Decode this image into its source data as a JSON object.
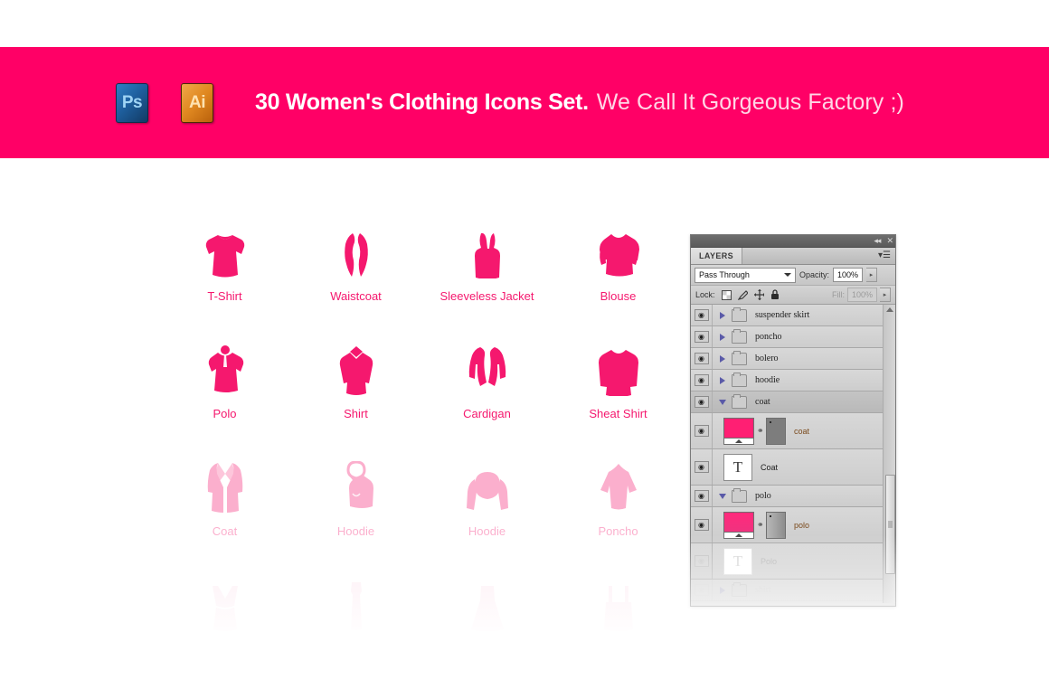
{
  "banner": {
    "background_color": "#ff0066",
    "badges": [
      {
        "name": "photoshop-badge",
        "label": "Ps"
      },
      {
        "name": "illustrator-badge",
        "label": "Ai"
      }
    ],
    "title_bold": "30 Women's Clothing Icons Set.",
    "title_light": "We Call It  Gorgeous Factory ;)"
  },
  "icon_grid": {
    "accent_color": "#f5186e",
    "rows": [
      {
        "opacity_class": "",
        "cells": [
          {
            "icon": "tshirt-icon",
            "label": "T-Shirt"
          },
          {
            "icon": "waistcoat-icon",
            "label": "Waistcoat"
          },
          {
            "icon": "sleeveless-jacket-icon",
            "label": "Sleeveless Jacket"
          },
          {
            "icon": "blouse-icon",
            "label": "Blouse"
          }
        ]
      },
      {
        "opacity_class": "",
        "cells": [
          {
            "icon": "polo-icon",
            "label": "Polo"
          },
          {
            "icon": "shirt-icon",
            "label": "Shirt"
          },
          {
            "icon": "cardigan-icon",
            "label": "Cardigan"
          },
          {
            "icon": "sweatshirt-icon",
            "label": "Sheat Shirt"
          }
        ]
      },
      {
        "opacity_class": "row-fade-1",
        "cells": [
          {
            "icon": "coat-icon",
            "label": "Coat"
          },
          {
            "icon": "hoodie-icon",
            "label": "Hoodie"
          },
          {
            "icon": "hoodie-open-icon",
            "label": "Hoodie"
          },
          {
            "icon": "poncho-icon",
            "label": "Poncho"
          }
        ]
      },
      {
        "opacity_class": "row-fade-2",
        "cells": [
          {
            "icon": "dress-v-icon",
            "label": ""
          },
          {
            "icon": "long-dress-icon",
            "label": ""
          },
          {
            "icon": "gown-icon",
            "label": ""
          },
          {
            "icon": "suspender-skirt-icon",
            "label": ""
          }
        ]
      }
    ]
  },
  "layers_panel": {
    "titlebar": {
      "collapse_label": "◂◂",
      "close_label": "✕"
    },
    "tab_label": "LAYERS",
    "menu_label": "▾☰",
    "blend_mode": "Pass Through",
    "opacity_label": "Opacity:",
    "opacity_value": "100%",
    "lock_label": "Lock:",
    "lock_icons": [
      "transparency-lock-icon",
      "paint-lock-icon",
      "move-lock-icon",
      "all-lock-icon"
    ],
    "fill_label": "Fill:",
    "fill_value": "100%",
    "spin_glyph": "▸",
    "eye_glyph": "◉",
    "text_layer_glyph": "T",
    "link_glyph": "⚭",
    "rows": [
      {
        "type": "group",
        "name": "suspender skirt",
        "expanded": false,
        "visible": true,
        "selected": false,
        "dim": false
      },
      {
        "type": "group",
        "name": "poncho",
        "expanded": false,
        "visible": true,
        "selected": false,
        "dim": false
      },
      {
        "type": "group",
        "name": "bolero",
        "expanded": false,
        "visible": true,
        "selected": false,
        "dim": false
      },
      {
        "type": "group",
        "name": "hoodie",
        "expanded": false,
        "visible": true,
        "selected": false,
        "dim": false
      },
      {
        "type": "group",
        "name": "coat",
        "expanded": true,
        "visible": true,
        "selected": true,
        "dim": false
      },
      {
        "type": "art",
        "name": "coat",
        "visible": true,
        "selected": false,
        "dim": false
      },
      {
        "type": "text",
        "name": "Coat",
        "visible": true,
        "selected": false,
        "dim": false
      },
      {
        "type": "group",
        "name": "polo",
        "expanded": true,
        "visible": true,
        "selected": false,
        "dim": false
      },
      {
        "type": "art",
        "name": "polo",
        "visible": true,
        "selected": false,
        "dim": false
      },
      {
        "type": "text",
        "name": "Polo",
        "visible": false,
        "selected": false,
        "dim": true
      },
      {
        "type": "group",
        "name": "shirt",
        "expanded": false,
        "visible": false,
        "selected": false,
        "dim": true
      }
    ]
  }
}
